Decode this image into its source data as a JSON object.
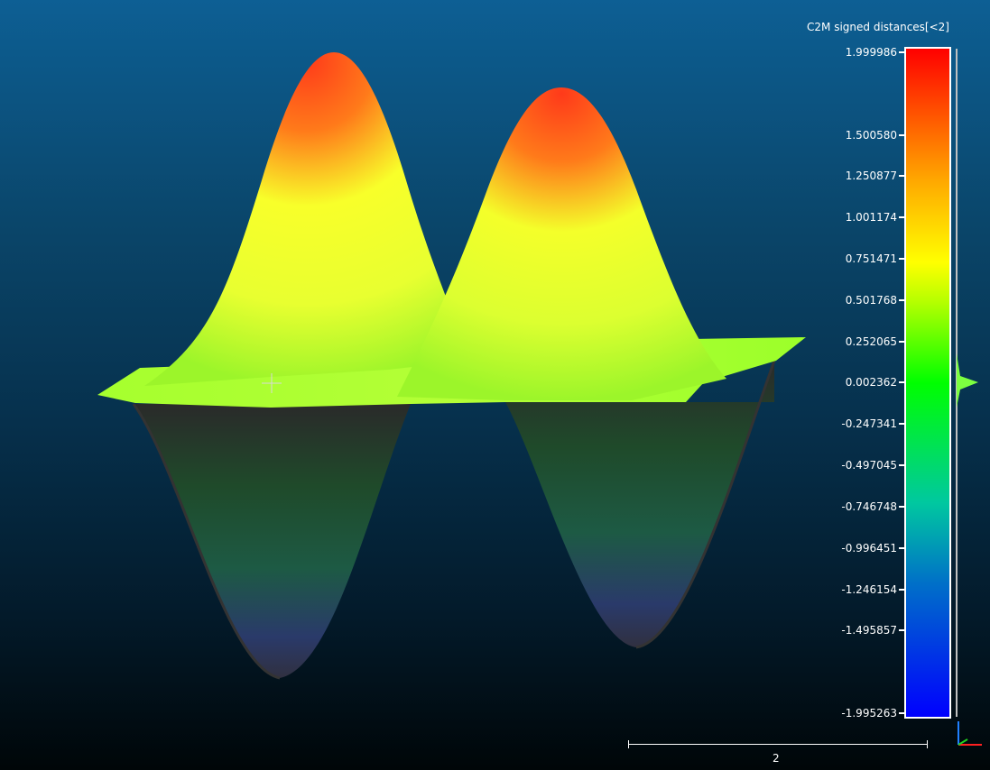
{
  "scalar_field": {
    "title": "C2M signed distances[<2]",
    "max": 1.999986,
    "min": -1.995263,
    "ticks": [
      {
        "label": "1.999986",
        "value": 1.999986
      },
      {
        "label": "1.500580",
        "value": 1.50058
      },
      {
        "label": "1.250877",
        "value": 1.250877
      },
      {
        "label": "1.001174",
        "value": 1.001174
      },
      {
        "label": "0.751471",
        "value": 0.751471
      },
      {
        "label": "0.501768",
        "value": 0.501768
      },
      {
        "label": "0.252065",
        "value": 0.252065
      },
      {
        "label": "0.002362",
        "value": 0.002362
      },
      {
        "label": "-0.247341",
        "value": -0.247341
      },
      {
        "label": "-0.497045",
        "value": -0.497045
      },
      {
        "label": "-0.746748",
        "value": -0.746748
      },
      {
        "label": "-0.996451",
        "value": -0.996451
      },
      {
        "label": "-1.246154",
        "value": -1.246154
      },
      {
        "label": "-1.495857",
        "value": -1.495857
      },
      {
        "label": "-1.995263",
        "value": -1.995263
      }
    ],
    "colors": {
      "high": "#ff0000",
      "mid_high": "#ffff00",
      "zero": "#00ff00",
      "low": "#0000ff"
    }
  },
  "scale_bar": {
    "label": "2"
  },
  "axis_triad": {
    "x_color": "#ff2020",
    "y_color": "#20d020",
    "z_color": "#2080ff"
  }
}
